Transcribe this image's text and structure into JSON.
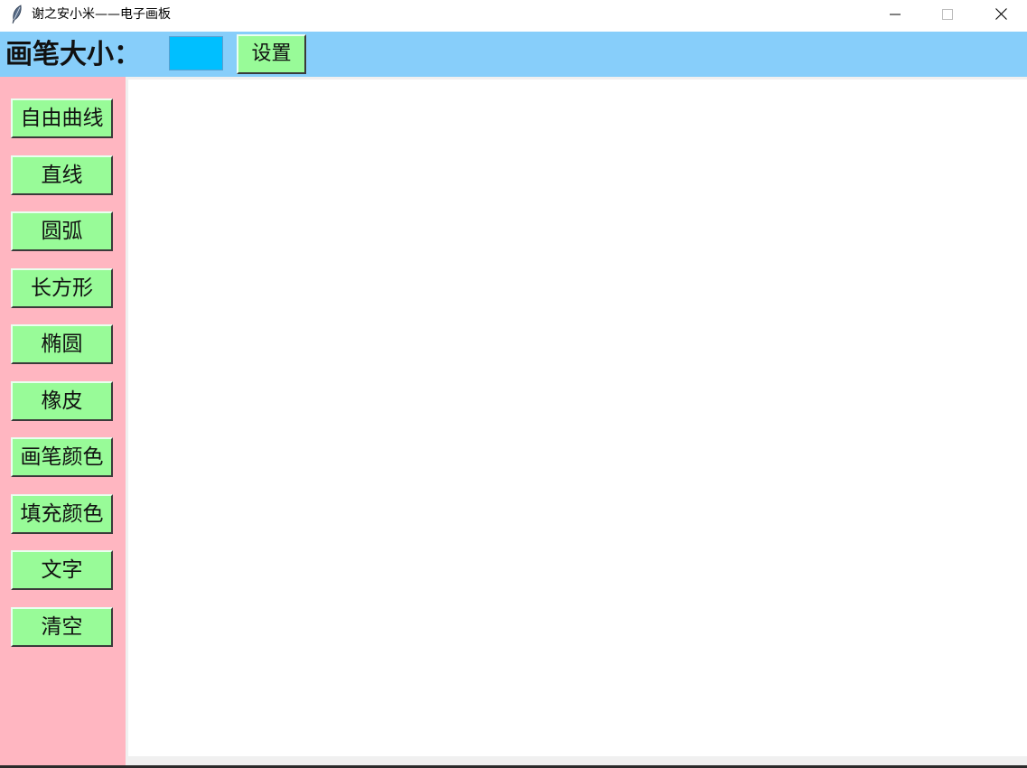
{
  "window": {
    "title": "谢之安小米——电子画板",
    "icon": "feather-icon",
    "controls": [
      "minimize-icon",
      "maximize-icon",
      "close-icon"
    ]
  },
  "toolbar": {
    "pen_size_label": "画笔大小：",
    "pen_size_value": "",
    "set_label": "设置"
  },
  "sidebar": {
    "tools": [
      {
        "label": "自由曲线"
      },
      {
        "label": "直线"
      },
      {
        "label": "圆弧"
      },
      {
        "label": "长方形"
      },
      {
        "label": "椭圆"
      },
      {
        "label": "橡皮"
      },
      {
        "label": "画笔颜色"
      },
      {
        "label": "填充颜色"
      },
      {
        "label": "文字"
      },
      {
        "label": "清空"
      }
    ]
  },
  "colors": {
    "toolbar_bg": "#87cefa",
    "sidebar_bg": "#ffb6c1",
    "button_bg": "#98fb98",
    "input_bg": "#00bfff",
    "canvas_bg": "#ffffff"
  }
}
